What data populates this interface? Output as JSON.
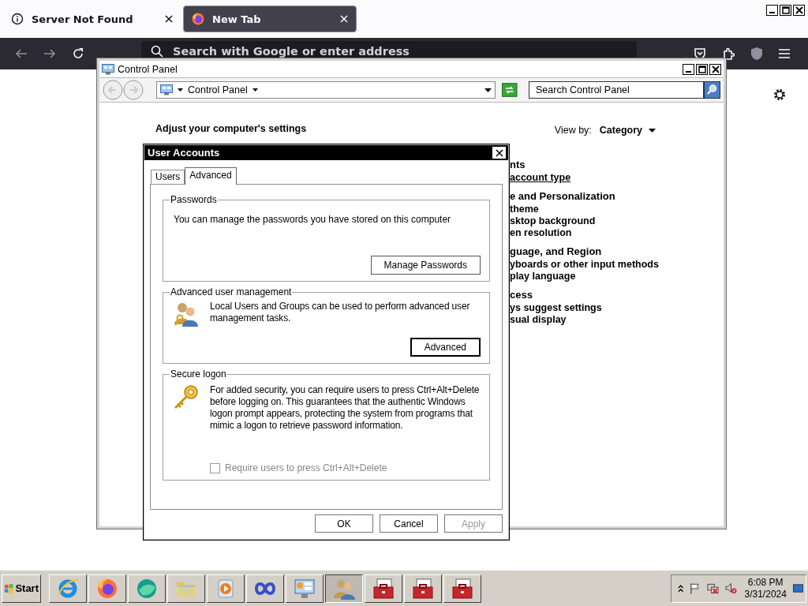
{
  "browser": {
    "tabs": [
      {
        "label": "Server Not Found",
        "kind": "info",
        "selected": false
      },
      {
        "label": "New Tab",
        "kind": "firefox",
        "selected": true
      }
    ],
    "address_placeholder": "Search with Google or enter address"
  },
  "control_panel": {
    "title": "Control Panel",
    "breadcrumb": "Control Panel",
    "search_placeholder": "Search Control Panel",
    "heading": "Adjust your computer's settings",
    "view_by_label": "View by:",
    "view_by_value": "Category",
    "categories": [
      {
        "heading": "nts",
        "links": [
          {
            "text": "account type",
            "hover": true
          }
        ]
      },
      {
        "heading": "e and Personalization",
        "links": [
          {
            "text": "theme",
            "hover": false
          },
          {
            "text": "sktop background",
            "hover": false
          },
          {
            "text": "en resolution",
            "hover": false
          }
        ]
      },
      {
        "heading": "guage, and Region",
        "links": [
          {
            "text": "yboards or other input methods",
            "hover": false
          },
          {
            "text": "play language",
            "hover": false
          }
        ]
      },
      {
        "heading": "cess",
        "links": [
          {
            "text": "ys suggest settings",
            "hover": false
          },
          {
            "text": "sual display",
            "hover": false
          }
        ]
      }
    ]
  },
  "dialog": {
    "title": "User Accounts",
    "tabs": [
      {
        "label": "Users",
        "selected": false
      },
      {
        "label": "Advanced",
        "selected": true
      }
    ],
    "passwords": {
      "legend": "Passwords",
      "text": "You can manage the passwords you have stored on this computer",
      "button": "Manage Passwords"
    },
    "advanced": {
      "legend": "Advanced user management",
      "text": "Local Users and Groups can be used to perform advanced user management tasks.",
      "button": "Advanced"
    },
    "secure_logon": {
      "legend": "Secure logon",
      "text": "For added security, you can require users to press Ctrl+Alt+Delete before logging on. This guarantees that the authentic Windows logon prompt appears, protecting the system from programs that mimic a logon to retrieve password information.",
      "checkbox": {
        "label": "Require users to press Ctrl+Alt+Delete",
        "checked": false,
        "disabled": true
      }
    },
    "buttons": [
      {
        "label": "OK",
        "disabled": false
      },
      {
        "label": "Cancel",
        "disabled": false
      },
      {
        "label": "Apply",
        "disabled": true
      }
    ]
  },
  "taskbar": {
    "start": "Start",
    "apps": [
      {
        "kind": "ie",
        "selected": false
      },
      {
        "kind": "firefox",
        "selected": false
      },
      {
        "kind": "sphere",
        "selected": false
      },
      {
        "kind": "folder",
        "selected": false
      },
      {
        "kind": "media",
        "selected": false
      },
      {
        "kind": "infinity",
        "selected": false
      },
      {
        "kind": "control",
        "selected": false
      },
      {
        "kind": "users",
        "selected": true
      },
      {
        "kind": "toolbox",
        "selected": false
      },
      {
        "kind": "toolbox",
        "selected": false
      },
      {
        "kind": "toolbox",
        "selected": false
      }
    ],
    "time": "6:08 PM",
    "date": "3/31/2024"
  }
}
